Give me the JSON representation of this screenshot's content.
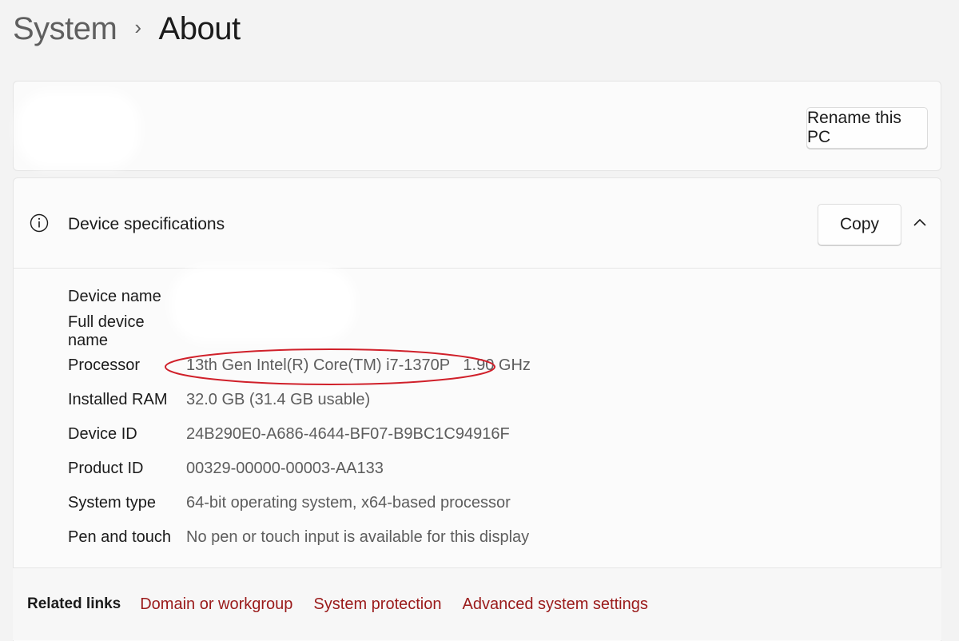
{
  "breadcrumb": {
    "parent": "System",
    "separator": "›",
    "current": "About"
  },
  "pc_card": {
    "rename_label": "Rename this PC"
  },
  "specs": {
    "title": "Device specifications",
    "copy_label": "Copy",
    "rows": [
      {
        "label": "Device name",
        "value": ""
      },
      {
        "label": "Full device name",
        "value": ""
      },
      {
        "label": "Processor",
        "value": "13th Gen Intel(R) Core(TM) i7-1370P   1.90 GHz"
      },
      {
        "label": "Installed RAM",
        "value": "32.0 GB (31.4 GB usable)"
      },
      {
        "label": "Device ID",
        "value": "24B290E0-A686-4644-BF07-B9BC1C94916F"
      },
      {
        "label": "Product ID",
        "value": "00329-00000-00003-AA133"
      },
      {
        "label": "System type",
        "value": "64-bit operating system, x64-based processor"
      },
      {
        "label": "Pen and touch",
        "value": "No pen or touch input is available for this display"
      }
    ]
  },
  "related": {
    "label": "Related links",
    "links": [
      "Domain or workgroup",
      "System protection",
      "Advanced system settings"
    ]
  },
  "colors": {
    "link": "#9a1a1a",
    "highlight": "#d0202a"
  },
  "icons": [
    "info-icon",
    "chevron-up-icon"
  ]
}
